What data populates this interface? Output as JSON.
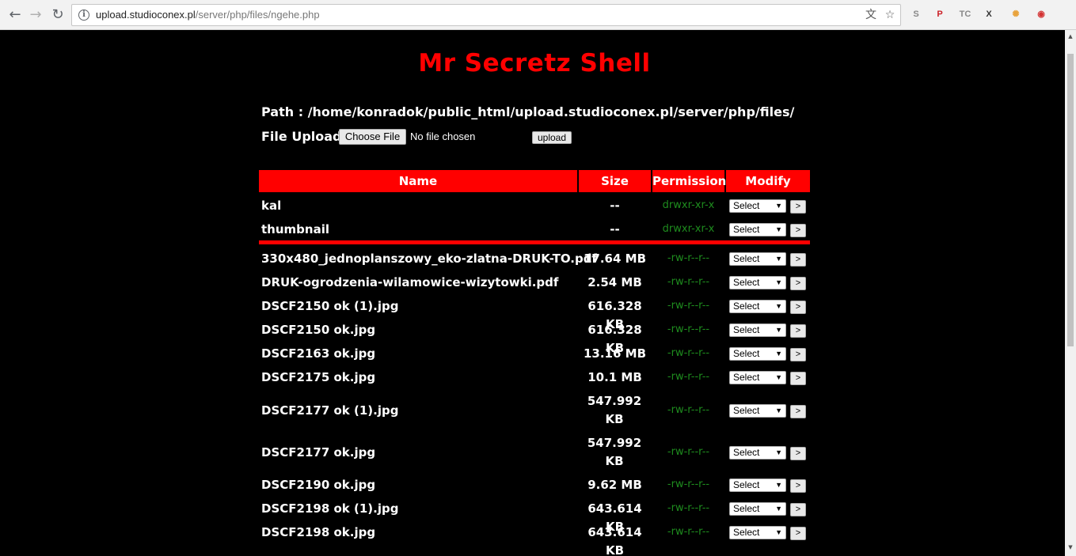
{
  "browser": {
    "url_host": "upload.studioconex.pl",
    "url_path": "/server/php/files/ngehe.php",
    "extensions": [
      {
        "icon": "s-extension-icon",
        "glyph": "S",
        "color": "#888888"
      },
      {
        "icon": "pinterest-icon",
        "glyph": "P",
        "color": "#cb2027"
      },
      {
        "icon": "tc-extension-icon",
        "glyph": "TC",
        "color": "#888888"
      },
      {
        "icon": "x-extension-icon",
        "glyph": "X",
        "color": "#333333"
      },
      {
        "icon": "pinwheel-extension-icon",
        "glyph": "✺",
        "color": "#e8a33d"
      },
      {
        "icon": "shield-extension-icon",
        "glyph": "◉",
        "color": "#d33333"
      }
    ]
  },
  "page": {
    "title": "Mr Secretz Shell",
    "path_label": "Path :",
    "path_value": "/home/konradok/public_html/upload.studioconex.pl/server/php/files/",
    "upload_label": "File Upload :",
    "choose_file": "Choose File",
    "no_file": "No file chosen",
    "upload_button": "upload"
  },
  "table": {
    "headers": {
      "name": "Name",
      "size": "Size",
      "permission": "Permission",
      "modify": "Modify"
    },
    "select_label": "Select",
    "go_label": ">",
    "dirs": [
      {
        "name": "kal",
        "size": "--",
        "perm": "drwxr-xr-x"
      },
      {
        "name": "thumbnail",
        "size": "--",
        "perm": "drwxr-xr-x"
      }
    ],
    "files": [
      {
        "name": "330x480_jednoplanszowy_eko-zlatna-DRUK-TO.pdf",
        "size": "17.64 MB",
        "perm": "-rw-r--r--"
      },
      {
        "name": "DRUK-ogrodzenia-wilamowice-wizytowki.pdf",
        "size": "2.54 MB",
        "perm": "-rw-r--r--"
      },
      {
        "name": "DSCF2150 ok (1).jpg",
        "size": "616.328 KB",
        "perm": "-rw-r--r--"
      },
      {
        "name": "DSCF2150 ok.jpg",
        "size": "616.328 KB",
        "perm": "-rw-r--r--"
      },
      {
        "name": "DSCF2163 ok.jpg",
        "size": "13.16 MB",
        "perm": "-rw-r--r--"
      },
      {
        "name": "DSCF2175 ok.jpg",
        "size": "10.1 MB",
        "perm": "-rw-r--r--"
      },
      {
        "name": "DSCF2177 ok (1).jpg",
        "size": "547.992 KB",
        "perm": "-rw-r--r--"
      },
      {
        "name": "DSCF2177 ok.jpg",
        "size": "547.992 KB",
        "perm": "-rw-r--r--"
      },
      {
        "name": "DSCF2190 ok.jpg",
        "size": "9.62 MB",
        "perm": "-rw-r--r--"
      },
      {
        "name": "DSCF2198 ok (1).jpg",
        "size": "643.614 KB",
        "perm": "-rw-r--r--"
      },
      {
        "name": "DSCF2198 ok.jpg",
        "size": "643.614 KB",
        "perm": "-rw-r--r--"
      }
    ]
  }
}
